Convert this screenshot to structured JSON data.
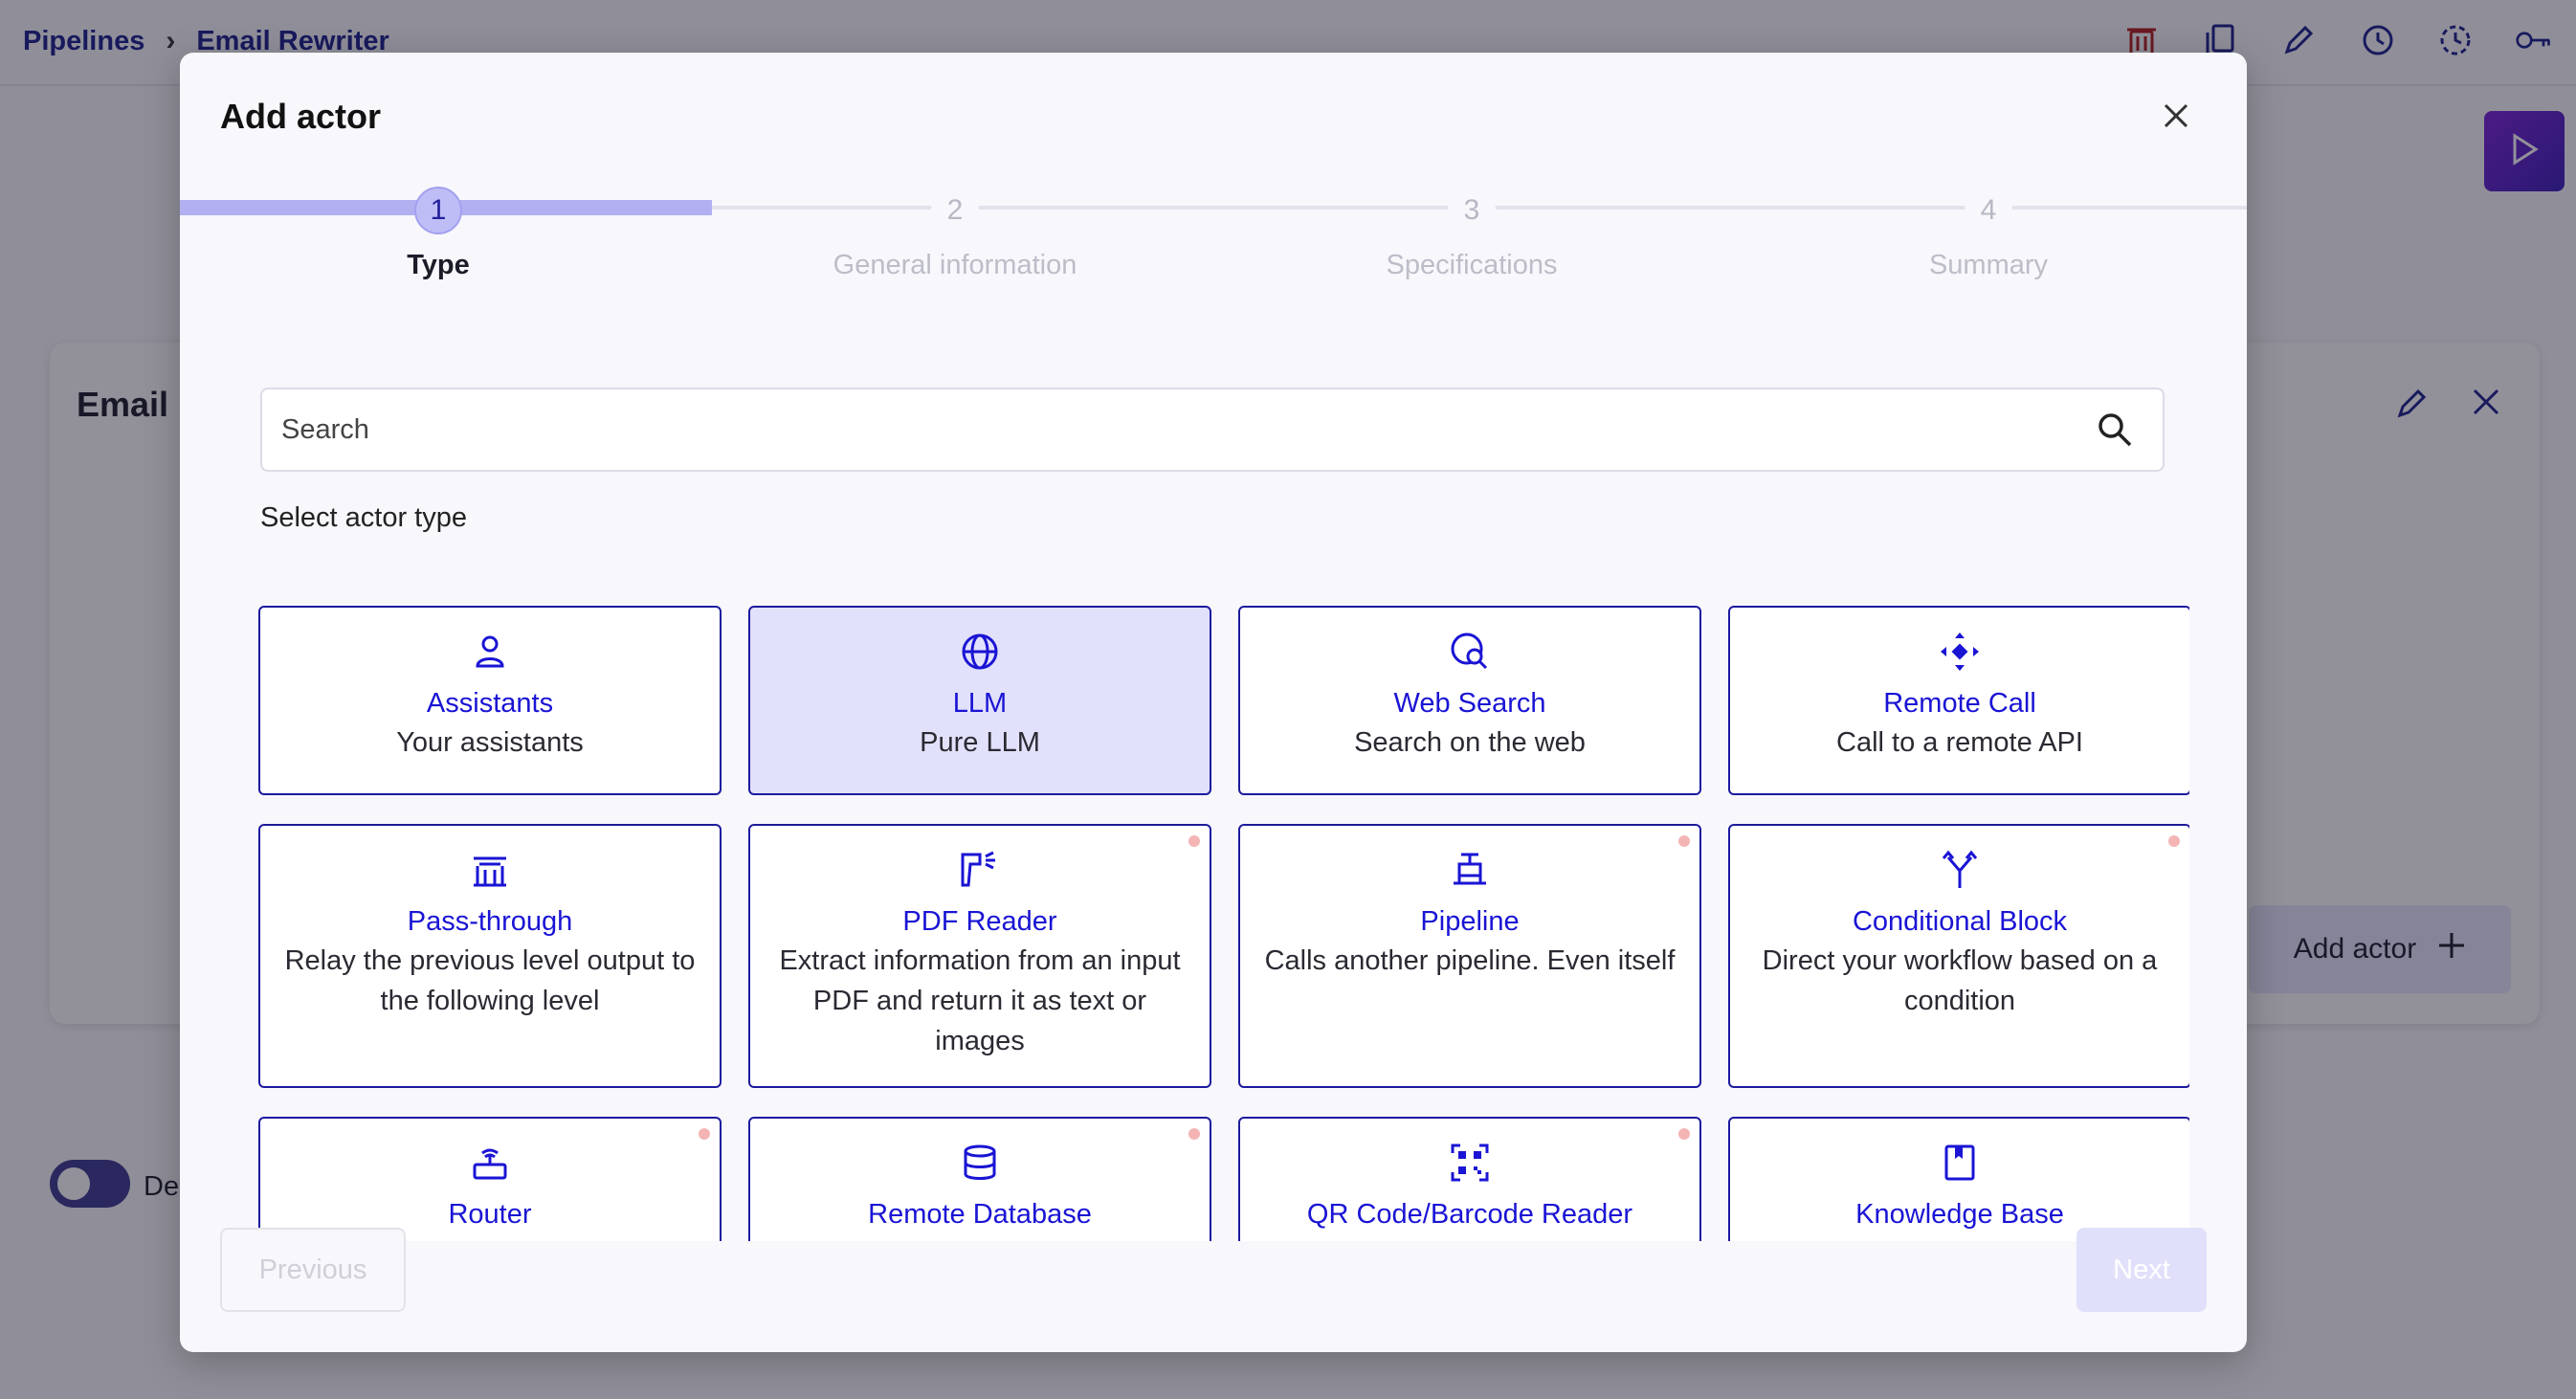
{
  "app": {
    "breadcrumb": [
      "Pipelines",
      "Email Rewriter"
    ],
    "card_title": "Email",
    "add_actor_label": "Add actor",
    "toggle_label": "De",
    "top_icons": [
      "delete-icon",
      "copy-icon",
      "edit-icon",
      "history-icon",
      "schedule-icon",
      "key-icon"
    ],
    "accent": "#1a1f8c"
  },
  "modal": {
    "title": "Add actor",
    "steps": [
      {
        "number": "1",
        "label": "Type",
        "active": true
      },
      {
        "number": "2",
        "label": "General information",
        "active": false
      },
      {
        "number": "3",
        "label": "Specifications",
        "active": false
      },
      {
        "number": "4",
        "label": "Summary",
        "active": false
      }
    ],
    "search": {
      "placeholder": "Search",
      "value": ""
    },
    "select_label": "Select actor type",
    "actor_types": [
      {
        "title": "Assistants",
        "description": "Your assistants",
        "icon": "person-icon",
        "selected": false,
        "dot": false
      },
      {
        "title": "LLM",
        "description": "Pure LLM",
        "icon": "globe-icon",
        "selected": true,
        "dot": false
      },
      {
        "title": "Web Search",
        "description": "Search on the web",
        "icon": "web-search-icon",
        "selected": false,
        "dot": false
      },
      {
        "title": "Remote Call",
        "description": "Call to a remote API",
        "icon": "remote-call-icon",
        "selected": false,
        "dot": false
      },
      {
        "title": "Pass-through",
        "description": "Relay the previous level output to the following level",
        "icon": "pass-through-icon",
        "selected": false,
        "dot": false
      },
      {
        "title": "PDF Reader",
        "description": "Extract information from an input PDF and return it as text or images",
        "icon": "scanner-icon",
        "selected": false,
        "dot": true
      },
      {
        "title": "Pipeline",
        "description": "Calls another pipeline. Even itself",
        "icon": "pipeline-icon",
        "selected": false,
        "dot": true
      },
      {
        "title": "Conditional Block",
        "description": "Direct your workflow based on a condition",
        "icon": "split-icon",
        "selected": false,
        "dot": true
      },
      {
        "title": "Router",
        "description": "",
        "icon": "router-icon",
        "selected": false,
        "dot": true
      },
      {
        "title": "Remote Database",
        "description": "",
        "icon": "database-icon",
        "selected": false,
        "dot": true
      },
      {
        "title": "QR Code/Barcode Reader",
        "description": "",
        "icon": "qr-code-icon",
        "selected": false,
        "dot": true
      },
      {
        "title": "Knowledge Base",
        "description": "",
        "icon": "book-icon",
        "selected": false,
        "dot": false
      }
    ],
    "previous_label": "Previous",
    "next_label": "Next",
    "card_accent": "#1a14d4",
    "selected_bg": "#e2e1fb",
    "step_done_color": "#b3b0f2"
  }
}
